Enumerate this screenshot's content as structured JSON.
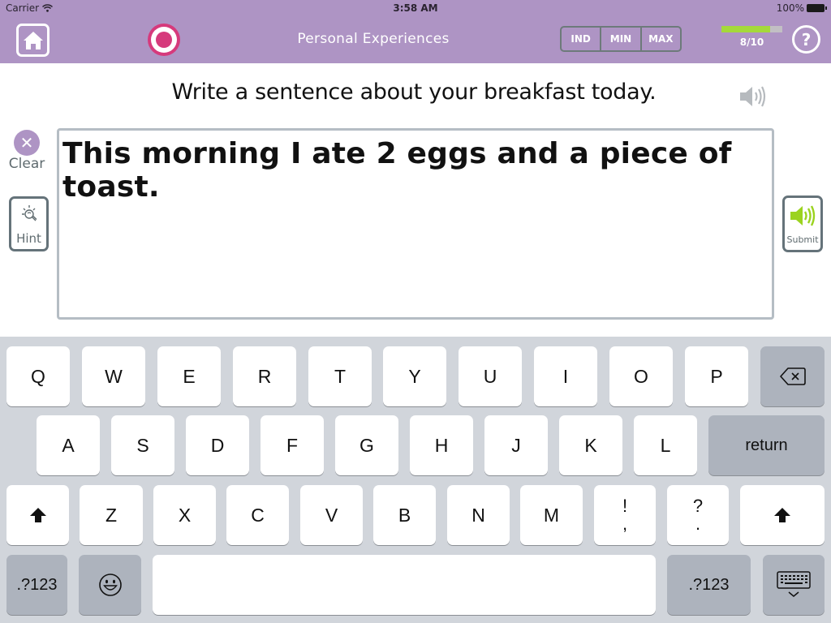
{
  "status_bar": {
    "carrier": "Carrier",
    "time": "3:58 AM",
    "battery": "100%"
  },
  "nav": {
    "title": "Personal Experiences",
    "levels": [
      "IND",
      "MIN",
      "MAX"
    ],
    "progress": {
      "current": 8,
      "total": 10,
      "label": "8/10",
      "fraction": 0.8
    },
    "help_label": "?"
  },
  "prompt": {
    "text": "Write a sentence about your breakfast today."
  },
  "side_buttons": {
    "clear_label": "Clear",
    "hint_label": "Hint",
    "submit_label": "Submit"
  },
  "answer": {
    "value": "This morning I ate 2 eggs and a piece of toast."
  },
  "colors": {
    "brand_purple": "#ae94c4",
    "record_pink": "#d63a7c",
    "progress_green": "#a5d93a",
    "submit_green": "#9bd31f",
    "keyboard_bg": "#d1d5db"
  },
  "keyboard": {
    "row1": [
      "Q",
      "W",
      "E",
      "R",
      "T",
      "Y",
      "U",
      "I",
      "O",
      "P"
    ],
    "row2": [
      "A",
      "S",
      "D",
      "F",
      "G",
      "H",
      "J",
      "K",
      "L"
    ],
    "row3": [
      "Z",
      "X",
      "C",
      "V",
      "B",
      "N",
      "M"
    ],
    "punct1": {
      "top": "!",
      "bottom": ","
    },
    "punct2": {
      "top": "?",
      "bottom": "."
    },
    "return_label": "return",
    "numbers_label": ".?123"
  }
}
